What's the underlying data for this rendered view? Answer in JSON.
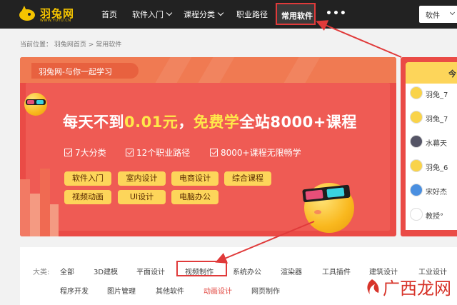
{
  "header": {
    "logo": {
      "name": "羽兔网",
      "url_text": "WWW.YUTU.CN"
    },
    "nav": [
      {
        "label": "首页",
        "has_dropdown": false
      },
      {
        "label": "软件入门",
        "has_dropdown": true
      },
      {
        "label": "课程分类",
        "has_dropdown": true
      },
      {
        "label": "职业路径",
        "has_dropdown": false
      },
      {
        "label": "常用软件",
        "has_dropdown": false,
        "highlighted": true
      }
    ],
    "more_label": "•••",
    "search_select": "软件"
  },
  "breadcrumb": {
    "prefix": "当前位置：",
    "items": [
      "羽兔网首页",
      "常用软件"
    ],
    "separator": ">"
  },
  "banner": {
    "tag": "羽兔网-与你一起学习",
    "headline_parts": [
      {
        "text": "每天不到",
        "highlight": false
      },
      {
        "text": "0.01元",
        "highlight": true
      },
      {
        "text": "，",
        "highlight": false
      },
      {
        "text": "免费学",
        "highlight": true
      },
      {
        "text": "全站8000+课程",
        "highlight": false
      }
    ],
    "features": [
      "7大分类",
      "12个职业路径",
      "8000+课程无限畅学"
    ],
    "tags_row1": [
      "软件入门",
      "室内设计",
      "电商设计",
      "综合课程"
    ],
    "tags_row2": [
      "视频动画",
      "UI设计",
      "电脑办公"
    ]
  },
  "side_panel": {
    "title": "今",
    "users": [
      {
        "name": "羽兔_7"
      },
      {
        "name": "羽兔_7"
      },
      {
        "name": "水幕天"
      },
      {
        "name": "羽兔_6"
      },
      {
        "name": "宋好杰"
      },
      {
        "name": "教授°"
      }
    ]
  },
  "categories": {
    "label": "大类:",
    "row1": [
      "全部",
      "3D建模",
      "平面设计",
      "视频制作",
      "系统办公",
      "渲染器",
      "工具插件",
      "建筑设计",
      "工业设计"
    ],
    "row2": [
      "程序开发",
      "图片管理",
      "其他软件",
      "动画设计",
      "网页制作"
    ],
    "highlighted": "视频制作",
    "active": "动画设计"
  },
  "watermark": {
    "text": "广西龙网"
  },
  "colors": {
    "topbar": "#222222",
    "brand_yellow": "#f5c400",
    "banner_red": "#ef5b54",
    "annotation_red": "#e03a3a",
    "pill_yellow": "#fdd55a",
    "active_text": "#e24a43"
  }
}
